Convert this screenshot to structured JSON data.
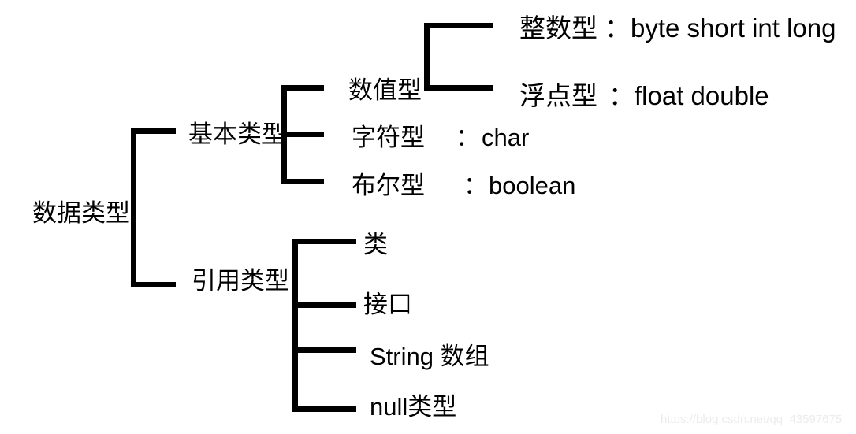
{
  "diagram": {
    "title": "数据类型",
    "root": {
      "label": "数据类型"
    },
    "level2": [
      {
        "label": "基本类型"
      },
      {
        "label": "引用类型"
      }
    ],
    "primitive_children": [
      {
        "label": "数值型",
        "separator": "",
        "types": ""
      },
      {
        "label": "字符型",
        "separator": "：",
        "types": "char"
      },
      {
        "label": "布尔型",
        "separator": "：",
        "types": "boolean"
      }
    ],
    "numeric_children": [
      {
        "label": "整数型",
        "separator": "：",
        "types": "byte short int long"
      },
      {
        "label": "浮点型",
        "separator": "：",
        "types": "float double"
      }
    ],
    "reference_children": [
      {
        "label": "类"
      },
      {
        "label": "接口"
      },
      {
        "label": "String  数组"
      },
      {
        "label": "null类型"
      }
    ]
  },
  "watermark": {
    "text": "https://blog.csdn.net/qq_43597675"
  },
  "colors": {
    "line": "#000000",
    "text": "#000000",
    "background": "#ffffff",
    "watermark": "#ececec"
  }
}
